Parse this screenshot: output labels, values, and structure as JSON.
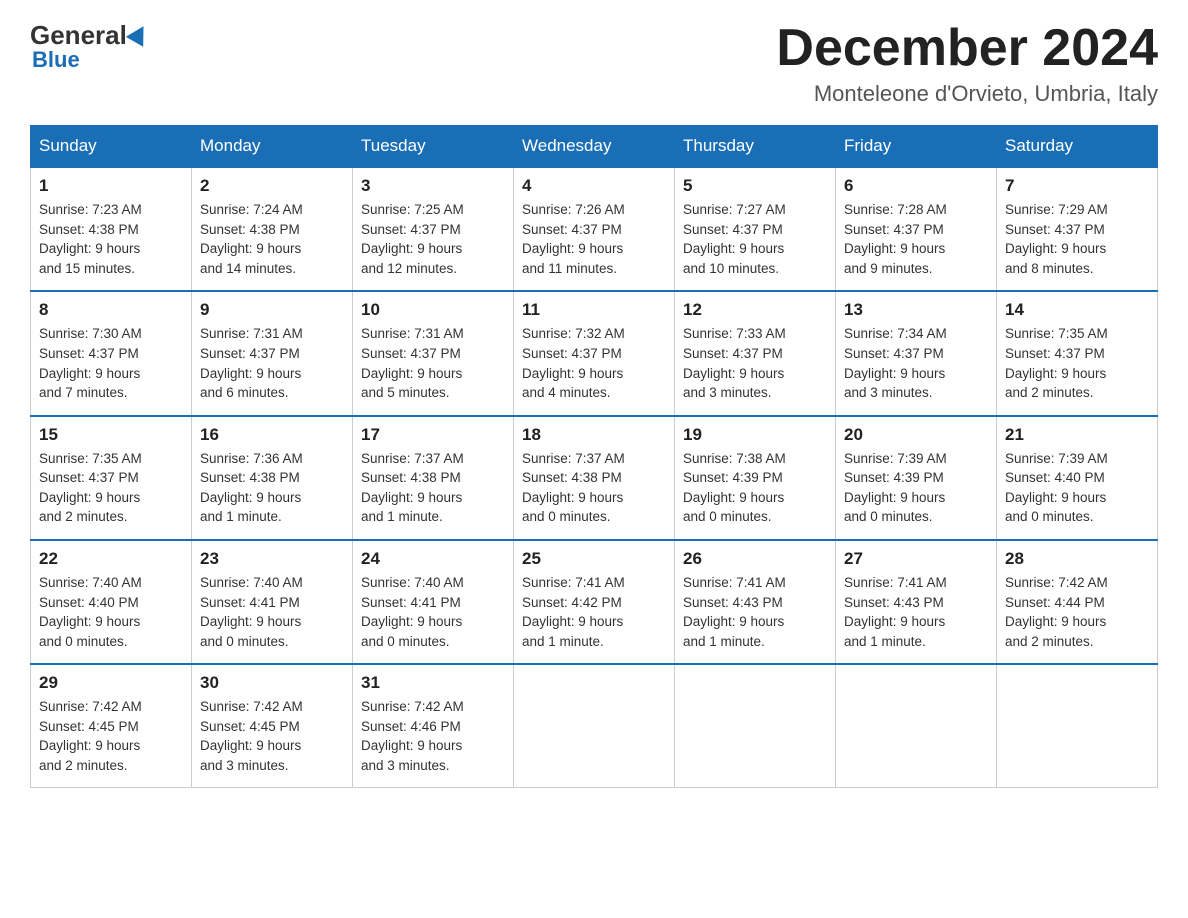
{
  "header": {
    "logo_general": "General",
    "logo_blue": "Blue",
    "month_title": "December 2024",
    "location": "Monteleone d'Orvieto, Umbria, Italy"
  },
  "weekdays": [
    "Sunday",
    "Monday",
    "Tuesday",
    "Wednesday",
    "Thursday",
    "Friday",
    "Saturday"
  ],
  "weeks": [
    [
      {
        "day": "1",
        "info": "Sunrise: 7:23 AM\nSunset: 4:38 PM\nDaylight: 9 hours\nand 15 minutes."
      },
      {
        "day": "2",
        "info": "Sunrise: 7:24 AM\nSunset: 4:38 PM\nDaylight: 9 hours\nand 14 minutes."
      },
      {
        "day": "3",
        "info": "Sunrise: 7:25 AM\nSunset: 4:37 PM\nDaylight: 9 hours\nand 12 minutes."
      },
      {
        "day": "4",
        "info": "Sunrise: 7:26 AM\nSunset: 4:37 PM\nDaylight: 9 hours\nand 11 minutes."
      },
      {
        "day": "5",
        "info": "Sunrise: 7:27 AM\nSunset: 4:37 PM\nDaylight: 9 hours\nand 10 minutes."
      },
      {
        "day": "6",
        "info": "Sunrise: 7:28 AM\nSunset: 4:37 PM\nDaylight: 9 hours\nand 9 minutes."
      },
      {
        "day": "7",
        "info": "Sunrise: 7:29 AM\nSunset: 4:37 PM\nDaylight: 9 hours\nand 8 minutes."
      }
    ],
    [
      {
        "day": "8",
        "info": "Sunrise: 7:30 AM\nSunset: 4:37 PM\nDaylight: 9 hours\nand 7 minutes."
      },
      {
        "day": "9",
        "info": "Sunrise: 7:31 AM\nSunset: 4:37 PM\nDaylight: 9 hours\nand 6 minutes."
      },
      {
        "day": "10",
        "info": "Sunrise: 7:31 AM\nSunset: 4:37 PM\nDaylight: 9 hours\nand 5 minutes."
      },
      {
        "day": "11",
        "info": "Sunrise: 7:32 AM\nSunset: 4:37 PM\nDaylight: 9 hours\nand 4 minutes."
      },
      {
        "day": "12",
        "info": "Sunrise: 7:33 AM\nSunset: 4:37 PM\nDaylight: 9 hours\nand 3 minutes."
      },
      {
        "day": "13",
        "info": "Sunrise: 7:34 AM\nSunset: 4:37 PM\nDaylight: 9 hours\nand 3 minutes."
      },
      {
        "day": "14",
        "info": "Sunrise: 7:35 AM\nSunset: 4:37 PM\nDaylight: 9 hours\nand 2 minutes."
      }
    ],
    [
      {
        "day": "15",
        "info": "Sunrise: 7:35 AM\nSunset: 4:37 PM\nDaylight: 9 hours\nand 2 minutes."
      },
      {
        "day": "16",
        "info": "Sunrise: 7:36 AM\nSunset: 4:38 PM\nDaylight: 9 hours\nand 1 minute."
      },
      {
        "day": "17",
        "info": "Sunrise: 7:37 AM\nSunset: 4:38 PM\nDaylight: 9 hours\nand 1 minute."
      },
      {
        "day": "18",
        "info": "Sunrise: 7:37 AM\nSunset: 4:38 PM\nDaylight: 9 hours\nand 0 minutes."
      },
      {
        "day": "19",
        "info": "Sunrise: 7:38 AM\nSunset: 4:39 PM\nDaylight: 9 hours\nand 0 minutes."
      },
      {
        "day": "20",
        "info": "Sunrise: 7:39 AM\nSunset: 4:39 PM\nDaylight: 9 hours\nand 0 minutes."
      },
      {
        "day": "21",
        "info": "Sunrise: 7:39 AM\nSunset: 4:40 PM\nDaylight: 9 hours\nand 0 minutes."
      }
    ],
    [
      {
        "day": "22",
        "info": "Sunrise: 7:40 AM\nSunset: 4:40 PM\nDaylight: 9 hours\nand 0 minutes."
      },
      {
        "day": "23",
        "info": "Sunrise: 7:40 AM\nSunset: 4:41 PM\nDaylight: 9 hours\nand 0 minutes."
      },
      {
        "day": "24",
        "info": "Sunrise: 7:40 AM\nSunset: 4:41 PM\nDaylight: 9 hours\nand 0 minutes."
      },
      {
        "day": "25",
        "info": "Sunrise: 7:41 AM\nSunset: 4:42 PM\nDaylight: 9 hours\nand 1 minute."
      },
      {
        "day": "26",
        "info": "Sunrise: 7:41 AM\nSunset: 4:43 PM\nDaylight: 9 hours\nand 1 minute."
      },
      {
        "day": "27",
        "info": "Sunrise: 7:41 AM\nSunset: 4:43 PM\nDaylight: 9 hours\nand 1 minute."
      },
      {
        "day": "28",
        "info": "Sunrise: 7:42 AM\nSunset: 4:44 PM\nDaylight: 9 hours\nand 2 minutes."
      }
    ],
    [
      {
        "day": "29",
        "info": "Sunrise: 7:42 AM\nSunset: 4:45 PM\nDaylight: 9 hours\nand 2 minutes."
      },
      {
        "day": "30",
        "info": "Sunrise: 7:42 AM\nSunset: 4:45 PM\nDaylight: 9 hours\nand 3 minutes."
      },
      {
        "day": "31",
        "info": "Sunrise: 7:42 AM\nSunset: 4:46 PM\nDaylight: 9 hours\nand 3 minutes."
      },
      {
        "day": "",
        "info": ""
      },
      {
        "day": "",
        "info": ""
      },
      {
        "day": "",
        "info": ""
      },
      {
        "day": "",
        "info": ""
      }
    ]
  ]
}
